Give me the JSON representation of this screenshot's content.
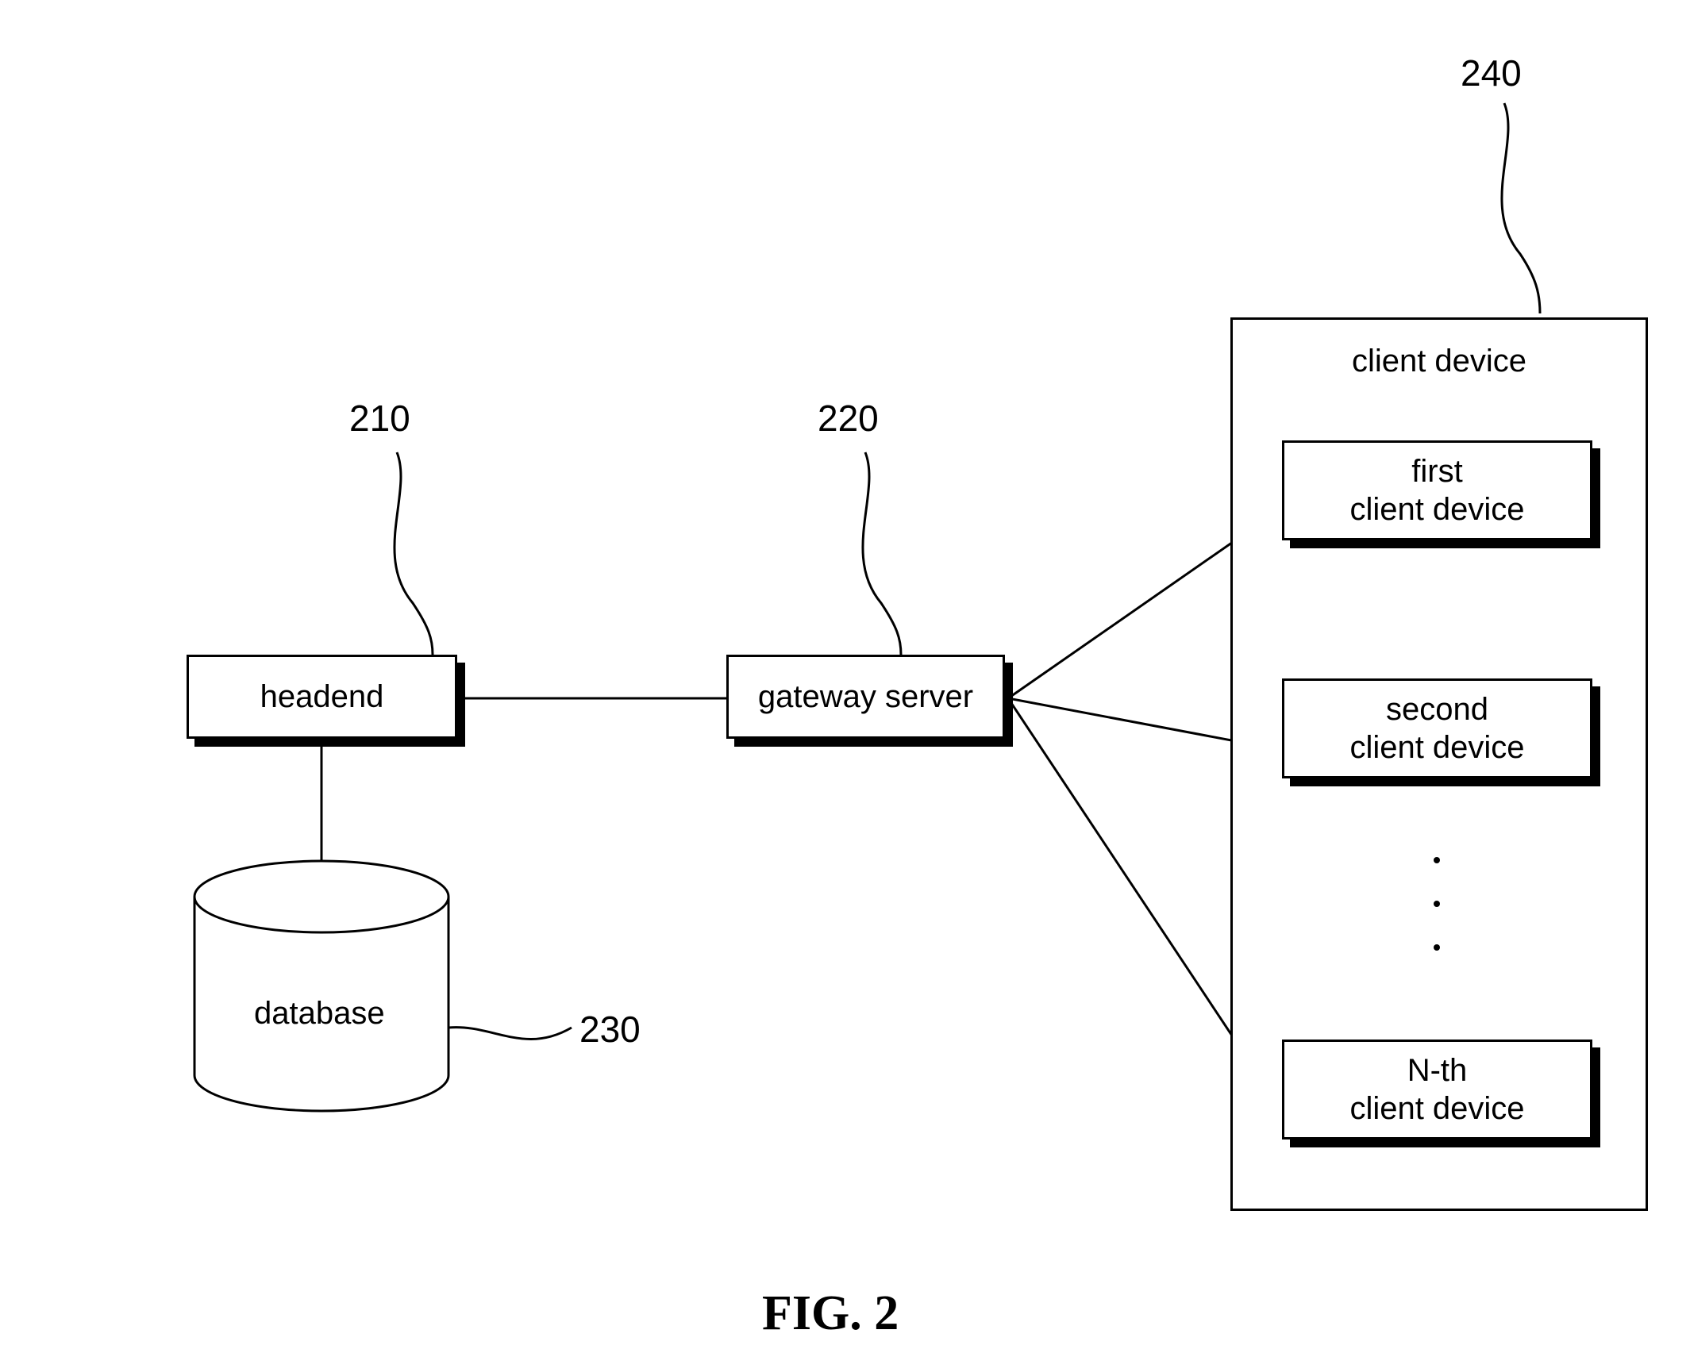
{
  "refs": {
    "headend": "210",
    "gateway": "220",
    "database": "230",
    "clientgroup": "240"
  },
  "boxes": {
    "headend": "headend",
    "gateway": "gateway server",
    "database": "database",
    "clientgroup_title": "client device",
    "client1_l1": "first",
    "client1_l2": "client device",
    "client2_l1": "second",
    "client2_l2": "client device",
    "clientN_l1": "N-th",
    "clientN_l2": "client device"
  },
  "caption": "FIG. 2"
}
